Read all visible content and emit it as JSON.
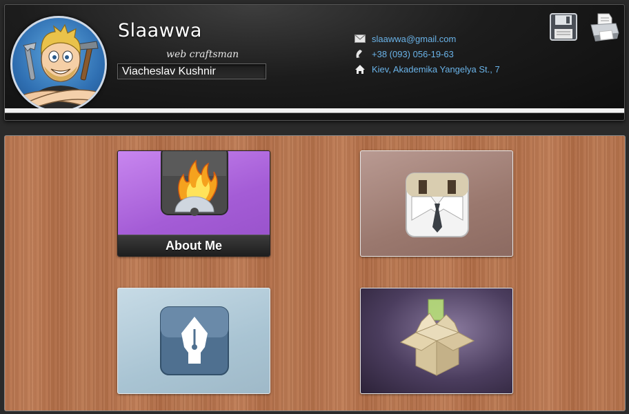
{
  "header": {
    "site_name": "Slaawwa",
    "tagline": "web craftsman",
    "full_name": "Viacheslav Kushnir",
    "contacts": {
      "email": "slaawwa@gmail.com",
      "phone": "+38 (093) 056-19-63",
      "address": "Kiev, Akademika Yangelya St., 7"
    },
    "icons": [
      "envelope-icon",
      "phone-icon",
      "home-icon",
      "save-icon",
      "printer-icon"
    ]
  },
  "tiles": [
    {
      "id": "about",
      "caption": "About Me",
      "icon": "burn-disc-icon",
      "accent": "#a45cd6"
    },
    {
      "id": "work",
      "caption": "",
      "icon": "suit-icon",
      "accent": "#9a786e"
    },
    {
      "id": "write",
      "caption": "",
      "icon": "pen-nib-icon",
      "accent": "#a9c4d3"
    },
    {
      "id": "box",
      "caption": "",
      "icon": "package-icon",
      "accent": "#4b3d5e"
    }
  ],
  "colors": {
    "link": "#6ab3e8",
    "header_bg": "#1c1c1c",
    "wood": "#b5724c"
  }
}
